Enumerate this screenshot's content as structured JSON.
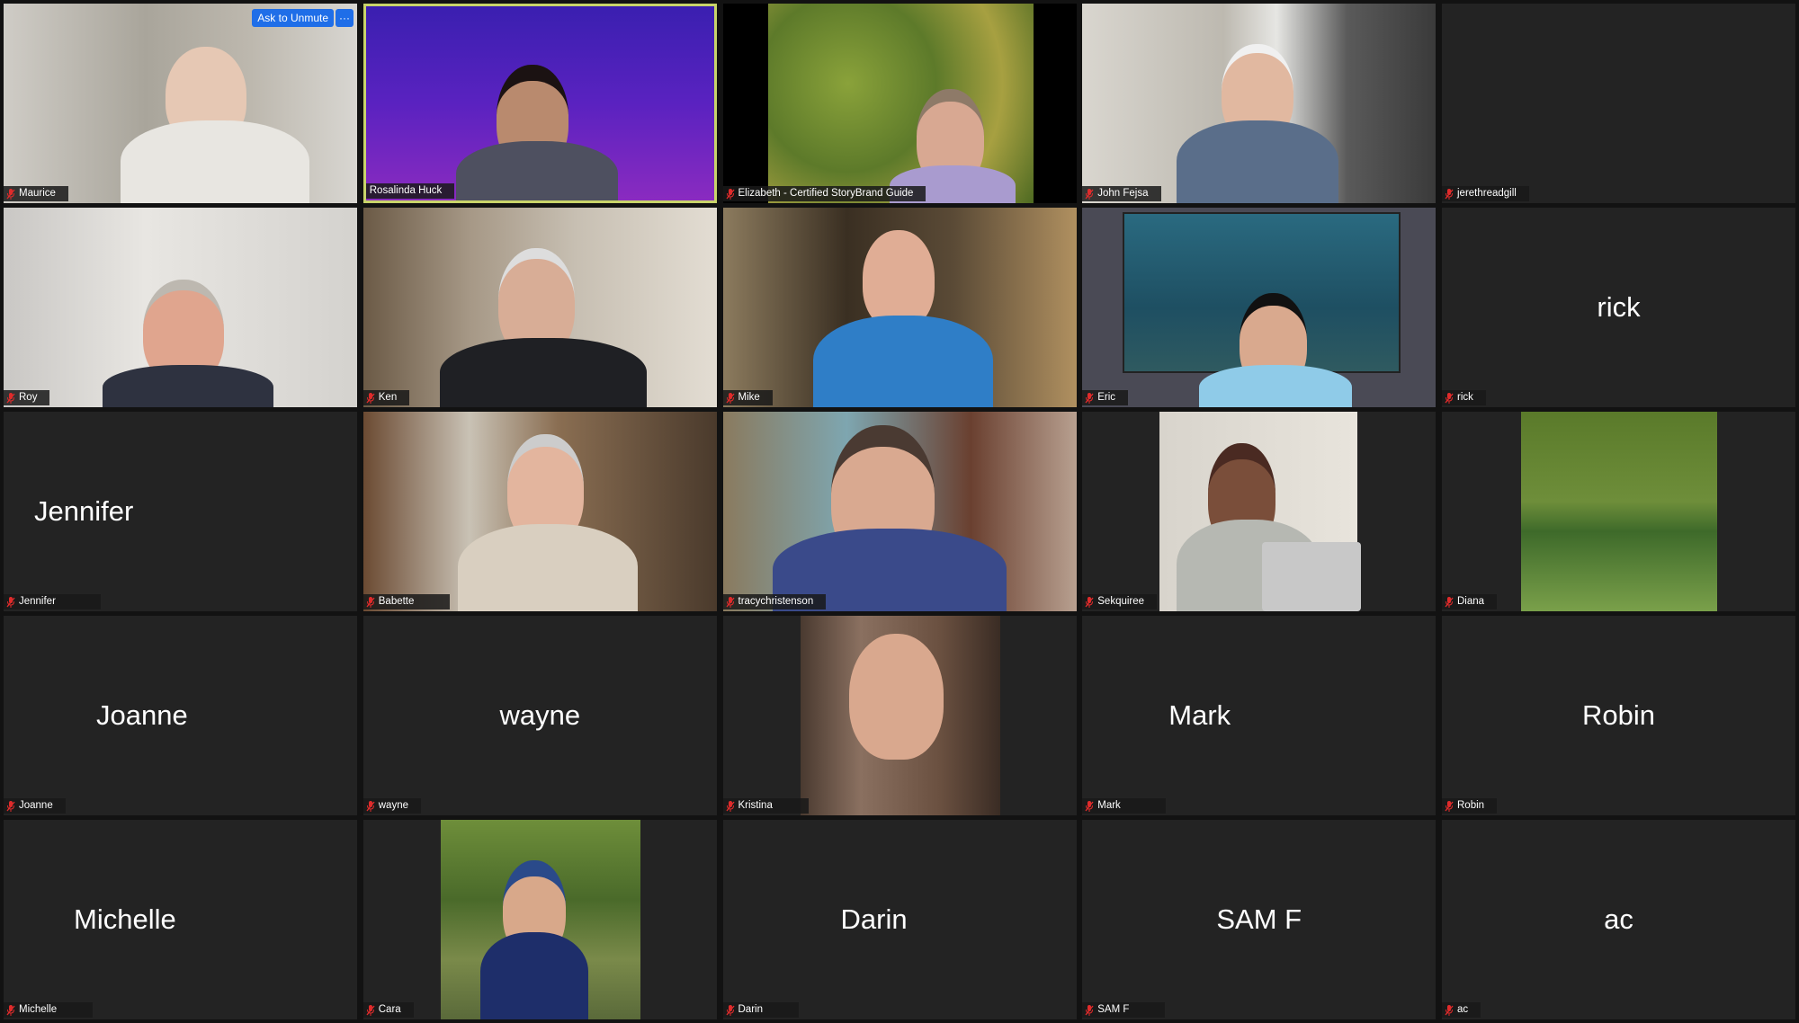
{
  "controls": {
    "ask_to_unmute": "Ask to Unmute",
    "more": "···"
  },
  "colors": {
    "active_speaker_border": "#c9d46a",
    "button_blue": "#1f6ee8",
    "muted_icon": "#e02b2b",
    "tile_bg": "#232323"
  },
  "participants": [
    {
      "name": "Maurice",
      "video": true,
      "muted": true
    },
    {
      "name": "Rosalinda Huck",
      "video": true,
      "muted": false,
      "speaking": true
    },
    {
      "name": "Elizabeth  - Certified StoryBrand Guide",
      "video": true,
      "muted": true
    },
    {
      "name": "John Fejsa",
      "video": true,
      "muted": true
    },
    {
      "name": "jerethreadgill",
      "video": false,
      "muted": true,
      "display_name": ""
    },
    {
      "name": "Roy",
      "video": true,
      "muted": true
    },
    {
      "name": "Ken",
      "video": true,
      "muted": true
    },
    {
      "name": "Mike",
      "video": true,
      "muted": true
    },
    {
      "name": "Eric",
      "video": true,
      "muted": true
    },
    {
      "name": "rick",
      "video": false,
      "muted": true,
      "display_name": "rick"
    },
    {
      "name": "Jennifer",
      "video": false,
      "muted": true,
      "display_name": "Jennifer"
    },
    {
      "name": "Babette",
      "video": true,
      "muted": true
    },
    {
      "name": "tracychristenson",
      "video": true,
      "muted": true
    },
    {
      "name": "Sekquiree",
      "video": true,
      "muted": true
    },
    {
      "name": "Diana",
      "video": true,
      "muted": true
    },
    {
      "name": "Joanne",
      "video": false,
      "muted": true,
      "display_name": "Joanne"
    },
    {
      "name": "wayne",
      "video": false,
      "muted": true,
      "display_name": "wayne"
    },
    {
      "name": "Kristina",
      "video": true,
      "muted": true
    },
    {
      "name": "Mark",
      "video": false,
      "muted": true,
      "display_name": "Mark"
    },
    {
      "name": "Robin",
      "video": false,
      "muted": true,
      "display_name": "Robin"
    },
    {
      "name": "Michelle",
      "video": false,
      "muted": true,
      "display_name": "Michelle"
    },
    {
      "name": "Cara",
      "video": true,
      "muted": true
    },
    {
      "name": "Darin",
      "video": false,
      "muted": true,
      "display_name": "Darin"
    },
    {
      "name": "SAM F",
      "video": false,
      "muted": true,
      "display_name": "SAM F"
    },
    {
      "name": "ac",
      "video": false,
      "muted": true,
      "display_name": "ac"
    }
  ]
}
